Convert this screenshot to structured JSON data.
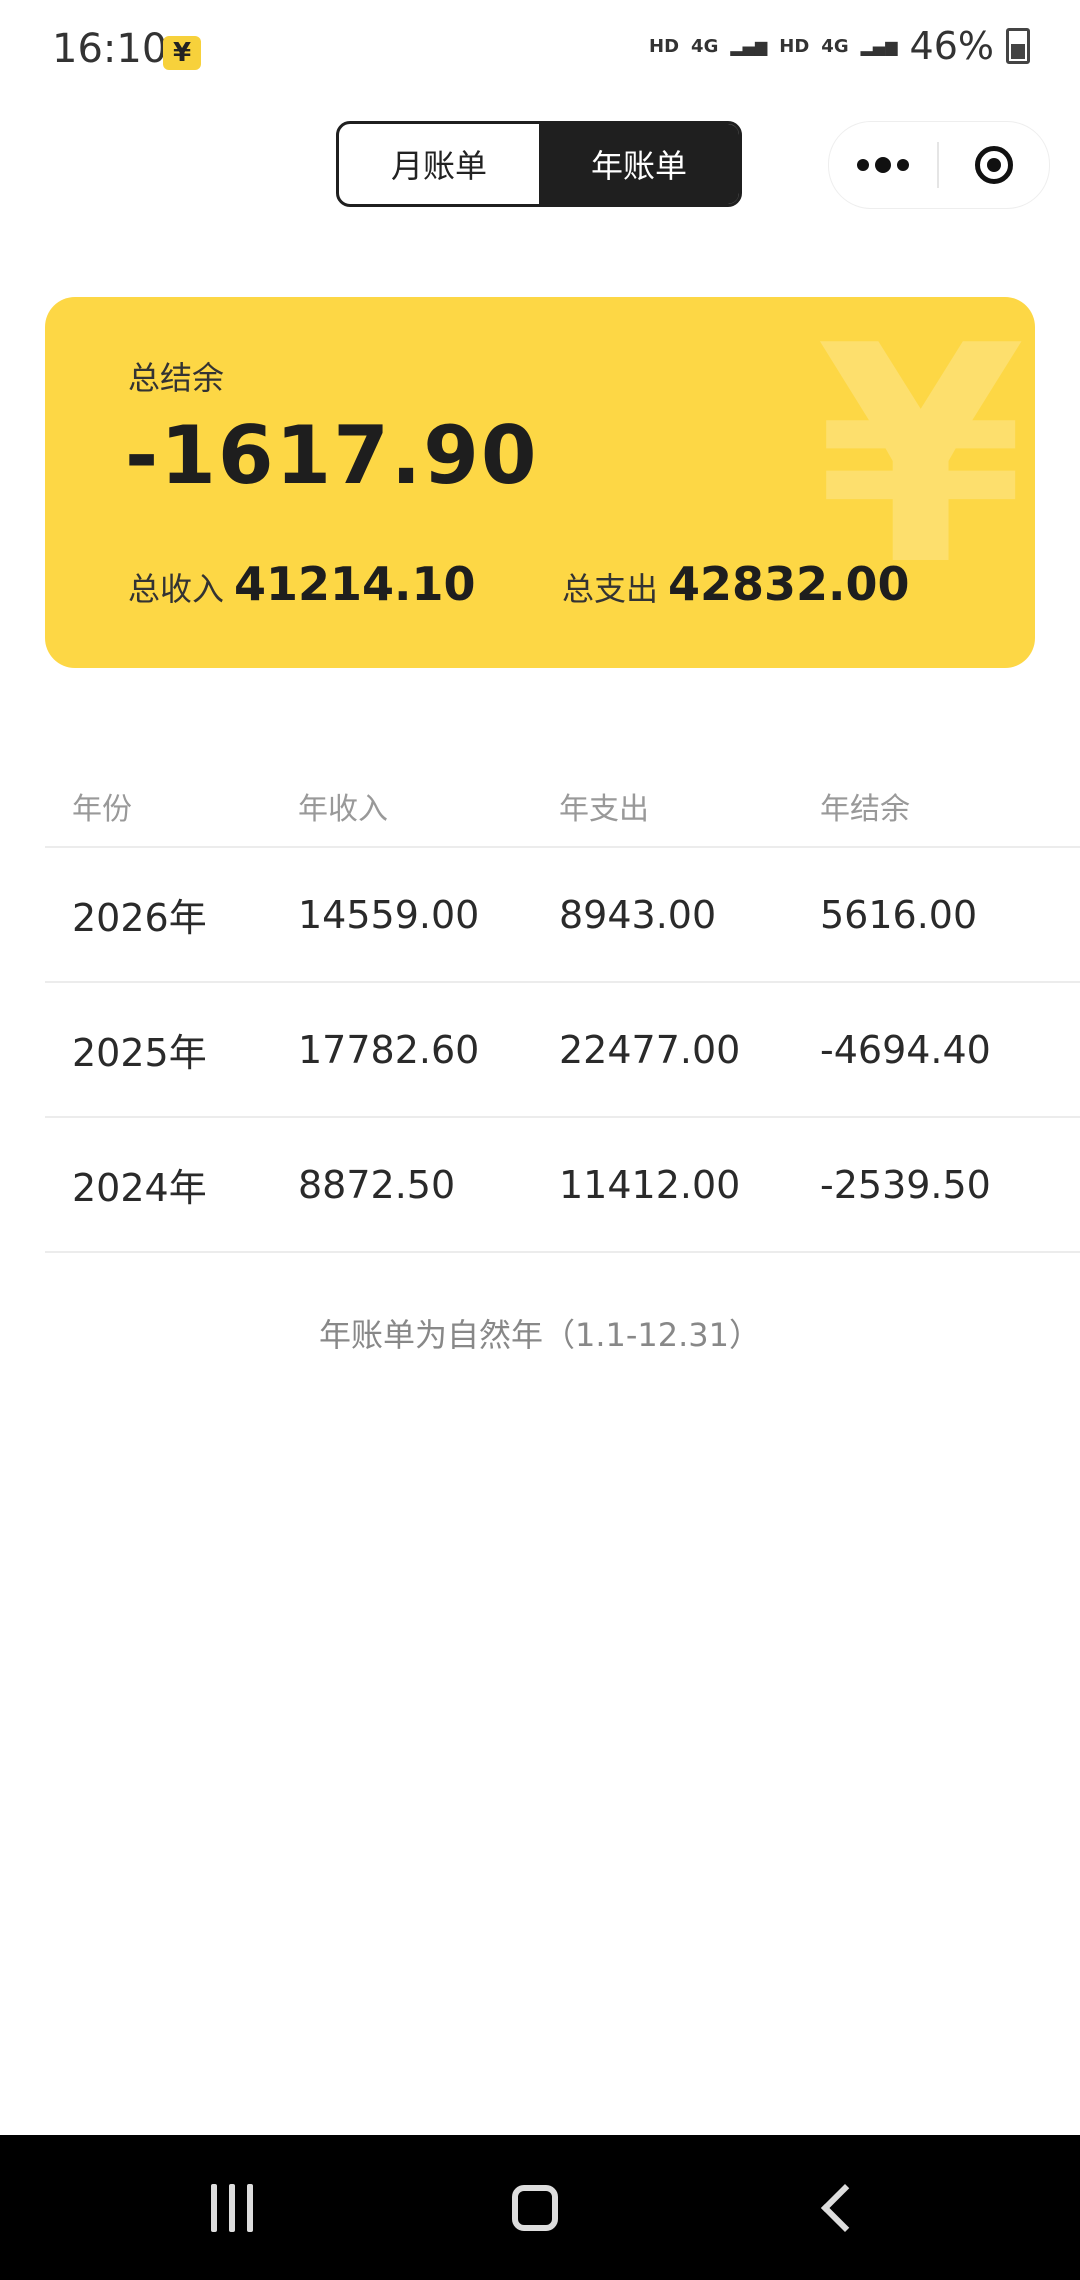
{
  "status_bar": {
    "time": "16:10",
    "app_icon_glyph": "¥",
    "signal_labels": [
      "HD",
      "4G",
      "HD",
      "4G"
    ],
    "battery_percent": "46%"
  },
  "tabs": [
    {
      "label": "月账单",
      "active": false
    },
    {
      "label": "年账单",
      "active": true
    }
  ],
  "summary": {
    "balance_label": "总结余",
    "balance_value": "-1617.90",
    "income_label": "总收入",
    "income_value": "41214.10",
    "expense_label": "总支出",
    "expense_value": "42832.00",
    "watermark_glyph": "¥",
    "card_color": "#fdd745"
  },
  "table": {
    "headers": [
      "年份",
      "年收入",
      "年支出",
      "年结余"
    ],
    "rows": [
      [
        "2026年",
        "14559.00",
        "8943.00",
        "5616.00"
      ],
      [
        "2025年",
        "17782.60",
        "22477.00",
        "-4694.40"
      ],
      [
        "2024年",
        "8872.50",
        "11412.00",
        "-2539.50"
      ]
    ]
  },
  "footnote": "年账单为自然年（1.1-12.31）",
  "icons": {
    "more": "more-dots-icon",
    "close": "target-close-icon",
    "battery": "battery-icon",
    "nav_recents": "recents-icon",
    "nav_home": "home-icon",
    "nav_back": "back-icon"
  }
}
